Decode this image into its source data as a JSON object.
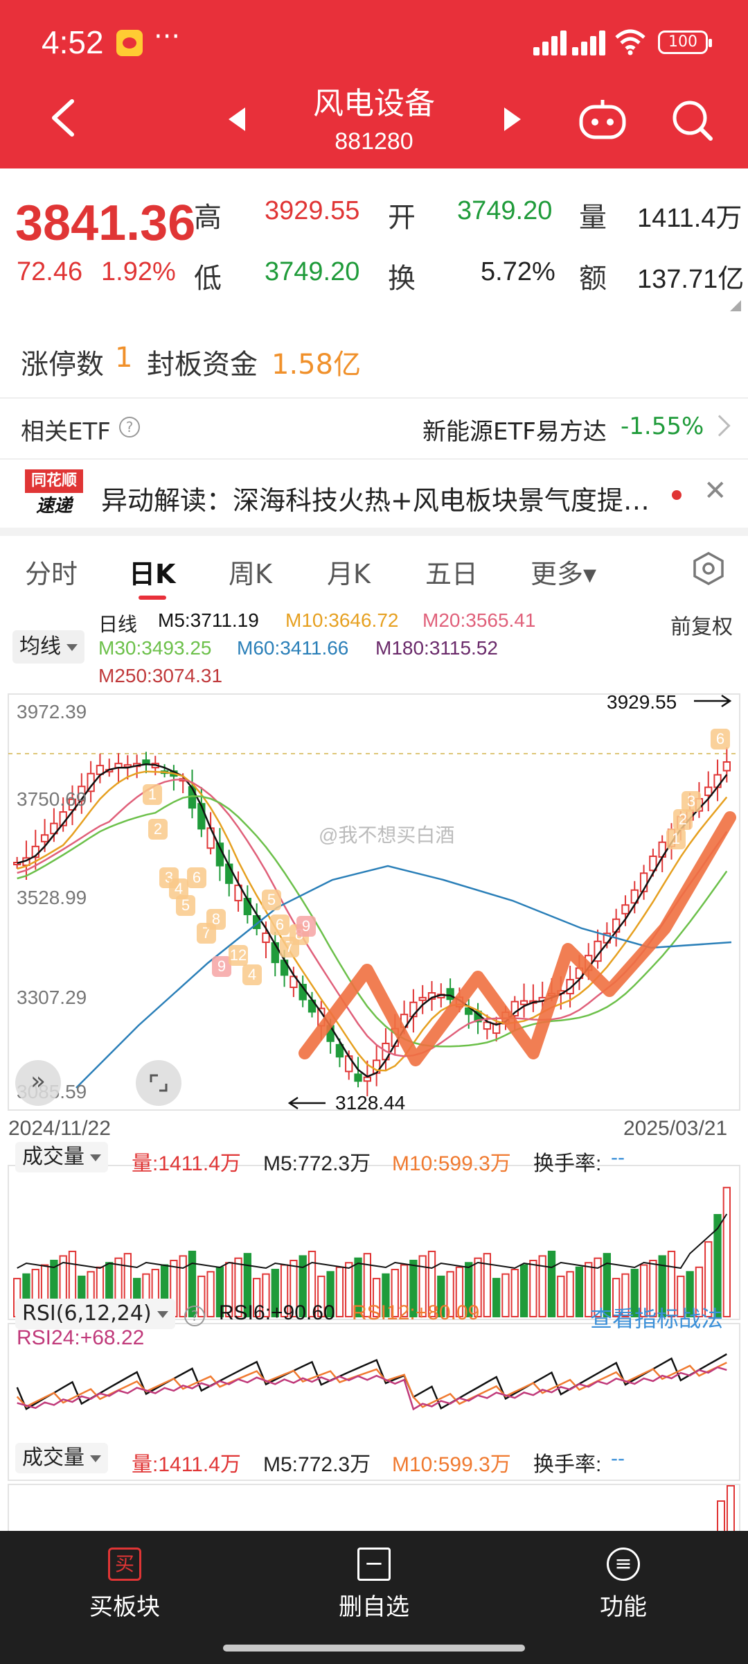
{
  "status_bar": {
    "time": "4:52",
    "dots": "···",
    "battery": "100"
  },
  "header": {
    "title": "风电设备",
    "code": "881280"
  },
  "quote": {
    "price": "3841.36",
    "change": "72.46",
    "change_pct": "1.92%",
    "high_label": "高",
    "high": "3929.55",
    "open_label": "开",
    "open": "3749.20",
    "volume_label": "量",
    "volume": "1411.4万",
    "low_label": "低",
    "low": "3749.20",
    "turnover_label": "换",
    "turnover": "5.72%",
    "amount_label": "额",
    "amount": "137.71亿"
  },
  "limit": {
    "count_label": "涨停数",
    "count": "1",
    "fund_label": "封板资金",
    "fund": "1.58亿"
  },
  "etf": {
    "label": "相关ETF",
    "help": "?",
    "name": "新能源ETF易方达",
    "change": "-1.55%"
  },
  "news": {
    "logo_top": "同花顺",
    "logo_bottom": "速递",
    "text": "异动解读：深海科技火热+风电板块景气度提…",
    "close": "✕"
  },
  "tabs": [
    {
      "label": "分时"
    },
    {
      "label": "日K"
    },
    {
      "label": "周K"
    },
    {
      "label": "月K"
    },
    {
      "label": "五日"
    },
    {
      "label": "更多▾"
    }
  ],
  "chart": {
    "ma_type": "均线",
    "period": "日线",
    "adjust": "前复权",
    "ma5": "M5:3711.19",
    "ma10": "M10:3646.72",
    "ma20": "M20:3565.41",
    "ma30": "M30:3493.25",
    "ma60": "M60:3411.66",
    "ma180": "M180:3115.52",
    "ma250": "M250:3074.31",
    "y_labels": [
      "3972.39",
      "3750.69",
      "3528.99",
      "3307.29",
      "3085.59"
    ],
    "high_marker": "3929.55",
    "low_marker": "3128.44",
    "date_start": "2024/11/22",
    "date_end": "2025/03/21",
    "watermark": "@我不想买白酒",
    "colors": {
      "ma5": "#111111",
      "ma10": "#e6a020",
      "ma20": "#e0607a",
      "ma30": "#6cc04a",
      "ma60": "#2a7fb8",
      "ma180": "#6a2a6a",
      "ma250": "#c0393b",
      "up": "#e03535",
      "down": "#1f9b3a",
      "overlay": "#f07040"
    }
  },
  "volume": {
    "label": "成交量",
    "vol": "量:1411.4万",
    "m5": "M5:772.3万",
    "m10": "M10:599.3万",
    "turnover": "换手率:",
    "turnover_val": "--"
  },
  "rsi": {
    "label": "RSI(6,12,24)",
    "rsi6": "RSI6:+90.60",
    "rsi12": "RSI12:+80.09",
    "rsi24": "RSI24:+68.22",
    "link": "查看指标战法"
  },
  "bottom_nav": [
    {
      "label": "买板块",
      "icon_glyph": "买"
    },
    {
      "label": "删自选",
      "icon_glyph": "−"
    },
    {
      "label": "功能",
      "icon_glyph": "≡"
    }
  ]
}
